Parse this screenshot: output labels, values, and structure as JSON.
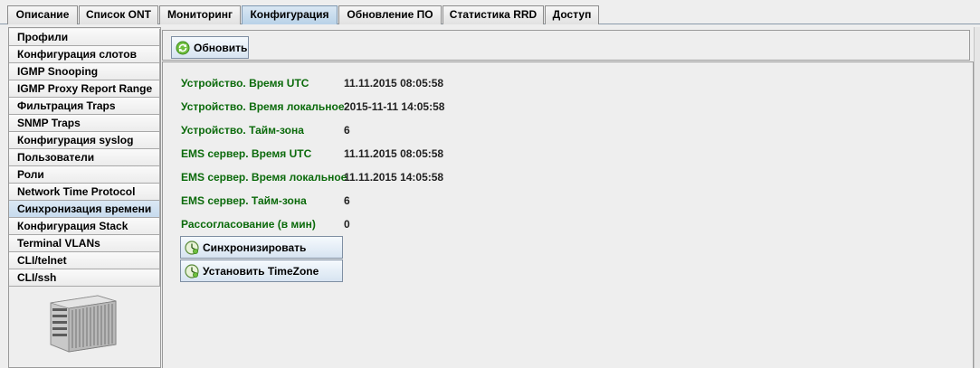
{
  "tabs": [
    {
      "label": "Описание"
    },
    {
      "label": "Список ONT"
    },
    {
      "label": "Мониторинг"
    },
    {
      "label": "Конфигурация",
      "active": true
    },
    {
      "label": "Обновление ПО"
    },
    {
      "label": "Статистика RRD"
    },
    {
      "label": "Доступ"
    }
  ],
  "sidebar": {
    "items": [
      {
        "label": "Профили"
      },
      {
        "label": "Конфигурация слотов"
      },
      {
        "label": "IGMP Snooping"
      },
      {
        "label": "IGMP Proxy Report Range"
      },
      {
        "label": "Фильтрация Traps"
      },
      {
        "label": "SNMP Traps"
      },
      {
        "label": "Конфигурация syslog"
      },
      {
        "label": "Пользователи"
      },
      {
        "label": "Роли"
      },
      {
        "label": "Network Time Protocol"
      },
      {
        "label": "Синхронизация времени",
        "active": true
      },
      {
        "label": "Конфигурация Stack"
      },
      {
        "label": "Terminal VLANs"
      },
      {
        "label": "CLI/telnet"
      },
      {
        "label": "CLI/ssh"
      }
    ],
    "device_icon": "olt-chassis-icon"
  },
  "toolbar": {
    "refresh_label": "Обновить",
    "refresh_icon": "refresh-icon"
  },
  "fields": [
    {
      "label": "Устройство. Время UTC",
      "value": "11.11.2015 08:05:58"
    },
    {
      "label": "Устройство. Время локальное",
      "value": "2015-11-11 14:05:58"
    },
    {
      "label": "Устройство. Тайм-зона",
      "value": "6"
    },
    {
      "label": "EMS сервер. Время UTC",
      "value": "11.11.2015 08:05:58"
    },
    {
      "label": "EMS сервер. Время локальное",
      "value": "11.11.2015 14:05:58"
    },
    {
      "label": "EMS сервер. Тайм-зона",
      "value": "6"
    },
    {
      "label": "Рассогласование (в мин)",
      "value": "0"
    }
  ],
  "actions": {
    "sync_label": "Синхронизировать",
    "timezone_label": "Установить TimeZone",
    "action_icon": "clock-icon"
  },
  "colors": {
    "label_green": "#0b6a0b",
    "active_tab": "#b9d2e8"
  }
}
